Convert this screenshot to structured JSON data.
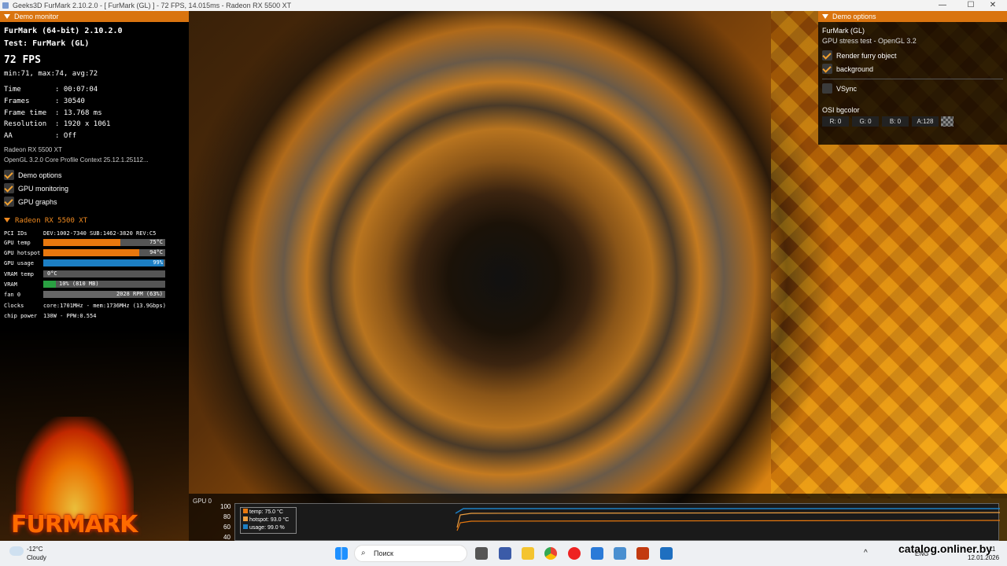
{
  "window": {
    "title": "Geeks3D FurMark 2.10.2.0 - [ FurMark (GL) ] - 72 FPS, 14.015ms - Radeon RX 5500 XT",
    "minimize": "—",
    "maximize": "☐",
    "close": "✕"
  },
  "demo_monitor": {
    "header": "Demo monitor",
    "app_line": "FurMark (64-bit) 2.10.2.0",
    "test_line": "Test: FurMark (GL)",
    "fps": "72 FPS",
    "fps_stats": "min:71, max:74, avg:72",
    "stats": [
      "Time        : 00:07:04",
      "Frames      : 30540",
      "Frame time  : 13.768 ms",
      "Resolution  : 1920 x 1061",
      "AA          : Off"
    ],
    "gpu_name": "Radeon RX 5500 XT",
    "gl_info": "OpenGL 3.2.0 Core Profile Context 25.12.1.25112...",
    "checkboxes": [
      {
        "label": "Demo options",
        "checked": true
      },
      {
        "label": "GPU monitoring",
        "checked": true
      },
      {
        "label": "GPU graphs",
        "checked": true
      }
    ]
  },
  "gpu_monitor": {
    "header": "Radeon RX 5500 XT",
    "pci_label": "PCI IDs",
    "pci_value": "DEV:1002-7340 SUB:1462-3820 REV:C5",
    "rows": [
      {
        "label": "GPU temp",
        "value": "75°C",
        "level": 0.63,
        "color": "#e8780e"
      },
      {
        "label": "GPU hotspot",
        "value": "94°C",
        "level": 0.79,
        "color": "#e8780e"
      },
      {
        "label": "GPU usage",
        "value": "99%",
        "level": 0.99,
        "color": "#1c7fc4"
      },
      {
        "label": "VRAM temp",
        "value": "0°C",
        "level": 0.0,
        "color": "#e8780e"
      },
      {
        "label": "VRAM",
        "value": "10% (810 MB)",
        "level": 0.1,
        "color": "#2aa042"
      },
      {
        "label": "fan 0",
        "value": "2028 RPM (63%)",
        "level": 0.63,
        "color": "#666666"
      }
    ],
    "clocks_label": "Clocks",
    "clocks_value": "core:1701MHz - mem:1736MHz (13.9Gbps)",
    "power_label": "chip power",
    "power_value": "130W - PPW:0.554"
  },
  "demo_options": {
    "header": "Demo options",
    "title": "FurMark (GL)",
    "subtitle": "GPU stress test - OpenGL 3.2",
    "options": [
      {
        "label": "Render furry object",
        "checked": true
      },
      {
        "label": "background",
        "checked": true
      },
      {
        "label": "VSync",
        "checked": false
      }
    ],
    "osi_label": "OSI bgcolor",
    "channels": [
      "R: 0",
      "G: 0",
      "B: 0",
      "A:128"
    ]
  },
  "graph": {
    "title": "GPU 0",
    "y_ticks": [
      "100",
      "80",
      "60",
      "40"
    ],
    "legend": [
      "temp: 75.0 °C",
      "hotspot: 93.0 °C",
      "usage: 99.0 %"
    ],
    "colors": {
      "temp": "#e8780e",
      "hotspot": "#f0a040",
      "usage": "#1c7fc4"
    }
  },
  "logo_text": "FURMARK",
  "taskbar": {
    "weather_temp": "-12°C",
    "weather_desc": "Cloudy",
    "search_placeholder": "Поиск",
    "lang": "ENG",
    "time": "11",
    "date": "12.01.2026",
    "watermark": "catalog.onliner.by"
  }
}
